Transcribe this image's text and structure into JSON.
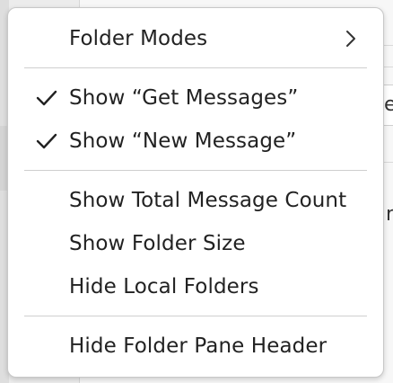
{
  "menu": {
    "items": [
      {
        "label": "Folder Modes",
        "checked": false,
        "has_submenu": true,
        "submenu_icon": "chevron-right-icon"
      },
      {
        "label": "Show “Get Messages”",
        "checked": true,
        "has_submenu": false,
        "check_icon": "checkmark-icon"
      },
      {
        "label": "Show “New Message”",
        "checked": true,
        "has_submenu": false,
        "check_icon": "checkmark-icon"
      },
      {
        "label": "Show Total Message Count",
        "checked": false,
        "has_submenu": false
      },
      {
        "label": "Show Folder Size",
        "checked": false,
        "has_submenu": false
      },
      {
        "label": "Hide Local Folders",
        "checked": false,
        "has_submenu": false
      },
      {
        "label": "Hide Folder Pane Header",
        "checked": false,
        "has_submenu": false
      }
    ]
  },
  "background": {
    "partial_glyph_1": "e",
    "partial_glyph_2": "n"
  },
  "colors": {
    "menu_background": "#ffffff",
    "menu_text": "#222222",
    "separator": "#cfcfcf",
    "menu_border": "#c8c8c8"
  }
}
